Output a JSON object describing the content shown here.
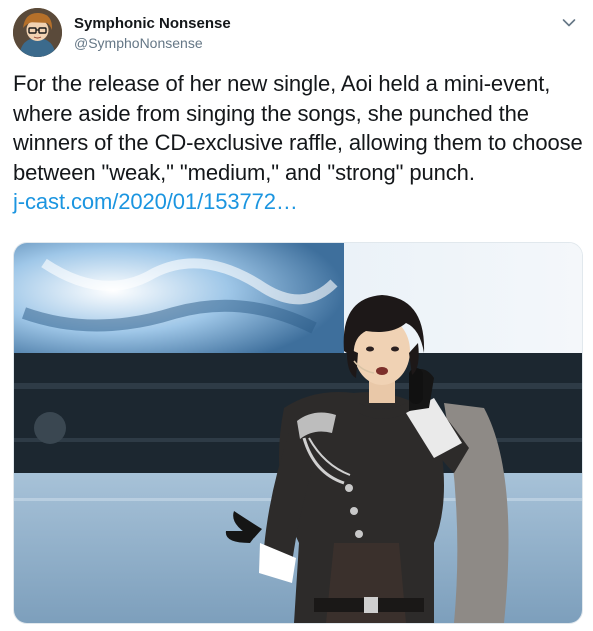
{
  "tweet": {
    "author": {
      "display_name": "Symphonic Nonsense",
      "handle": "@SymphoNonsense"
    },
    "body_text": "For the release of her new single, Aoi held a mini-event, where aside from singing the songs, she punched the winners of the CD-exclusive raffle, allowing them to choose between \"weak,\" \"medium,\" and \"strong\" punch.",
    "link_text": "j-cast.com/2020/01/153772…"
  },
  "colors": {
    "text": "#14171a",
    "secondary": "#657786",
    "link": "#1b95e0",
    "border": "#e1e8ed"
  },
  "icons": {
    "menu": "chevron-down-icon"
  }
}
